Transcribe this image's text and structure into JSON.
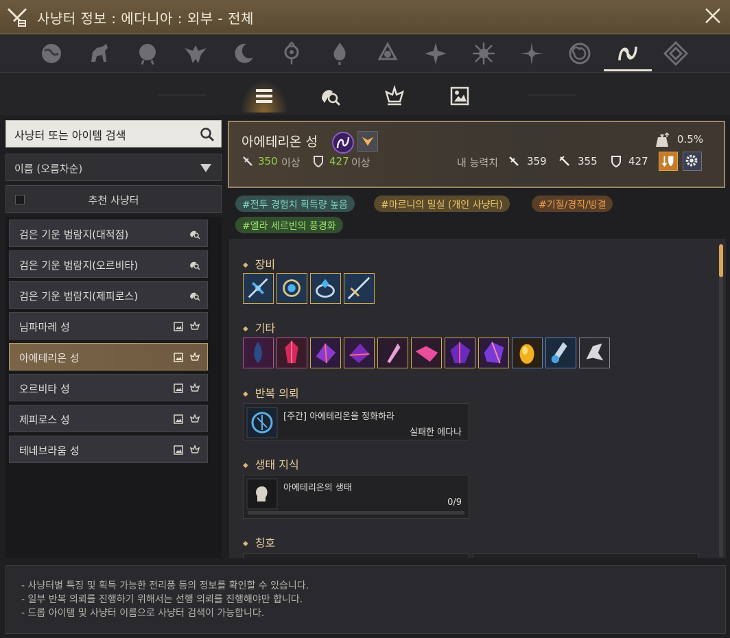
{
  "window": {
    "title": "사냥터 정보 : 에다니아 : 외부 - 전체",
    "close_icon": "close-icon"
  },
  "region_tabs": [
    {
      "icon": "globe-icon"
    },
    {
      "icon": "horse-icon"
    },
    {
      "icon": "lion-icon"
    },
    {
      "icon": "eagle-icon"
    },
    {
      "icon": "crescent-moon-icon"
    },
    {
      "icon": "orb-emblem-icon"
    },
    {
      "icon": "flame-emblem-icon"
    },
    {
      "icon": "knot-emblem-icon"
    },
    {
      "icon": "sun-burst-icon"
    },
    {
      "icon": "radiant-sun-icon"
    },
    {
      "icon": "star-burst-icon"
    },
    {
      "icon": "spiral-medallion-icon"
    },
    {
      "icon": "edania-emblem-icon",
      "active": true
    },
    {
      "icon": "lattice-emblem-icon"
    }
  ],
  "sub_tabs": [
    {
      "icon": "list-icon",
      "active": true
    },
    {
      "icon": "monster-search-icon"
    },
    {
      "icon": "boss-crown-icon"
    },
    {
      "icon": "picture-icon"
    }
  ],
  "search": {
    "value": "사냥터 또는 아이템 검색",
    "placeholder": "사냥터 또는 아이템 검색"
  },
  "sort": {
    "label": "이름 (오름차순)"
  },
  "recommend": {
    "label": "추천 사냥터",
    "checked": false
  },
  "areas": [
    {
      "name": "검은 기운 범람지(대적점)",
      "icons": [
        "monster-search-icon"
      ]
    },
    {
      "name": "검은 기운 범람지(오르비타)",
      "icons": [
        "monster-search-icon"
      ]
    },
    {
      "name": "검은 기운 범람지(제피로스)",
      "icons": [
        "monster-search-icon"
      ]
    },
    {
      "name": "님파마레 성",
      "icons": [
        "picture-icon",
        "boss-crown-icon"
      ]
    },
    {
      "name": "아에테리온 성",
      "icons": [
        "picture-icon",
        "boss-crown-icon"
      ],
      "selected": true
    },
    {
      "name": "오르비타 성",
      "icons": [
        "picture-icon",
        "boss-crown-icon"
      ]
    },
    {
      "name": "제피로스 성",
      "icons": [
        "picture-icon",
        "boss-crown-icon"
      ]
    },
    {
      "name": "테네브라움 성",
      "icons": [
        "picture-icon",
        "boss-crown-icon"
      ]
    }
  ],
  "info": {
    "name": "아에테리온 성",
    "req_attack": "350",
    "req_defense": "427",
    "above": "이상",
    "drop_rate": "0.5%",
    "my_stats_label": "내 능력치",
    "stat_ap": "359",
    "stat_aap": "355",
    "stat_dp": "427"
  },
  "tags": [
    {
      "text": "#전투 경험치 획득량 높음",
      "color": "teal"
    },
    {
      "text": "#마르니의 밀실 (개인 사냥터)",
      "color": "amber"
    },
    {
      "text": "#기절/경직/빙결",
      "color": "orange"
    },
    {
      "text": "#엘라 세르빈의 풍경화",
      "color": "green"
    }
  ],
  "sections": {
    "equipment": "장비",
    "other": "기타",
    "quest": "반복 의뢰",
    "ecology": "생태 지식",
    "title": "칭호"
  },
  "quest": {
    "title": "[주간] 아에테리온을 정화하라",
    "giver": "실패한 에다나"
  },
  "ecology": {
    "title": "아에테리온의 생태",
    "progress": "0/9",
    "progress_fraction": 0
  },
  "footer": {
    "lines": [
      "- 사냥터별 특징 및 획득 가능한 전리품 등의 정보를 확인할 수 있습니다.",
      "- 일부 반복 의뢰를 진행하기 위해서는 선행 의뢰를 진행해야만 합니다.",
      "- 드롭 아이템 및 사냥터 이름으로 사냥터 검색이 가능합니다."
    ]
  },
  "colors": {
    "accent": "#d9a657",
    "selected": "#7a6447",
    "green": "#8fd34b"
  }
}
